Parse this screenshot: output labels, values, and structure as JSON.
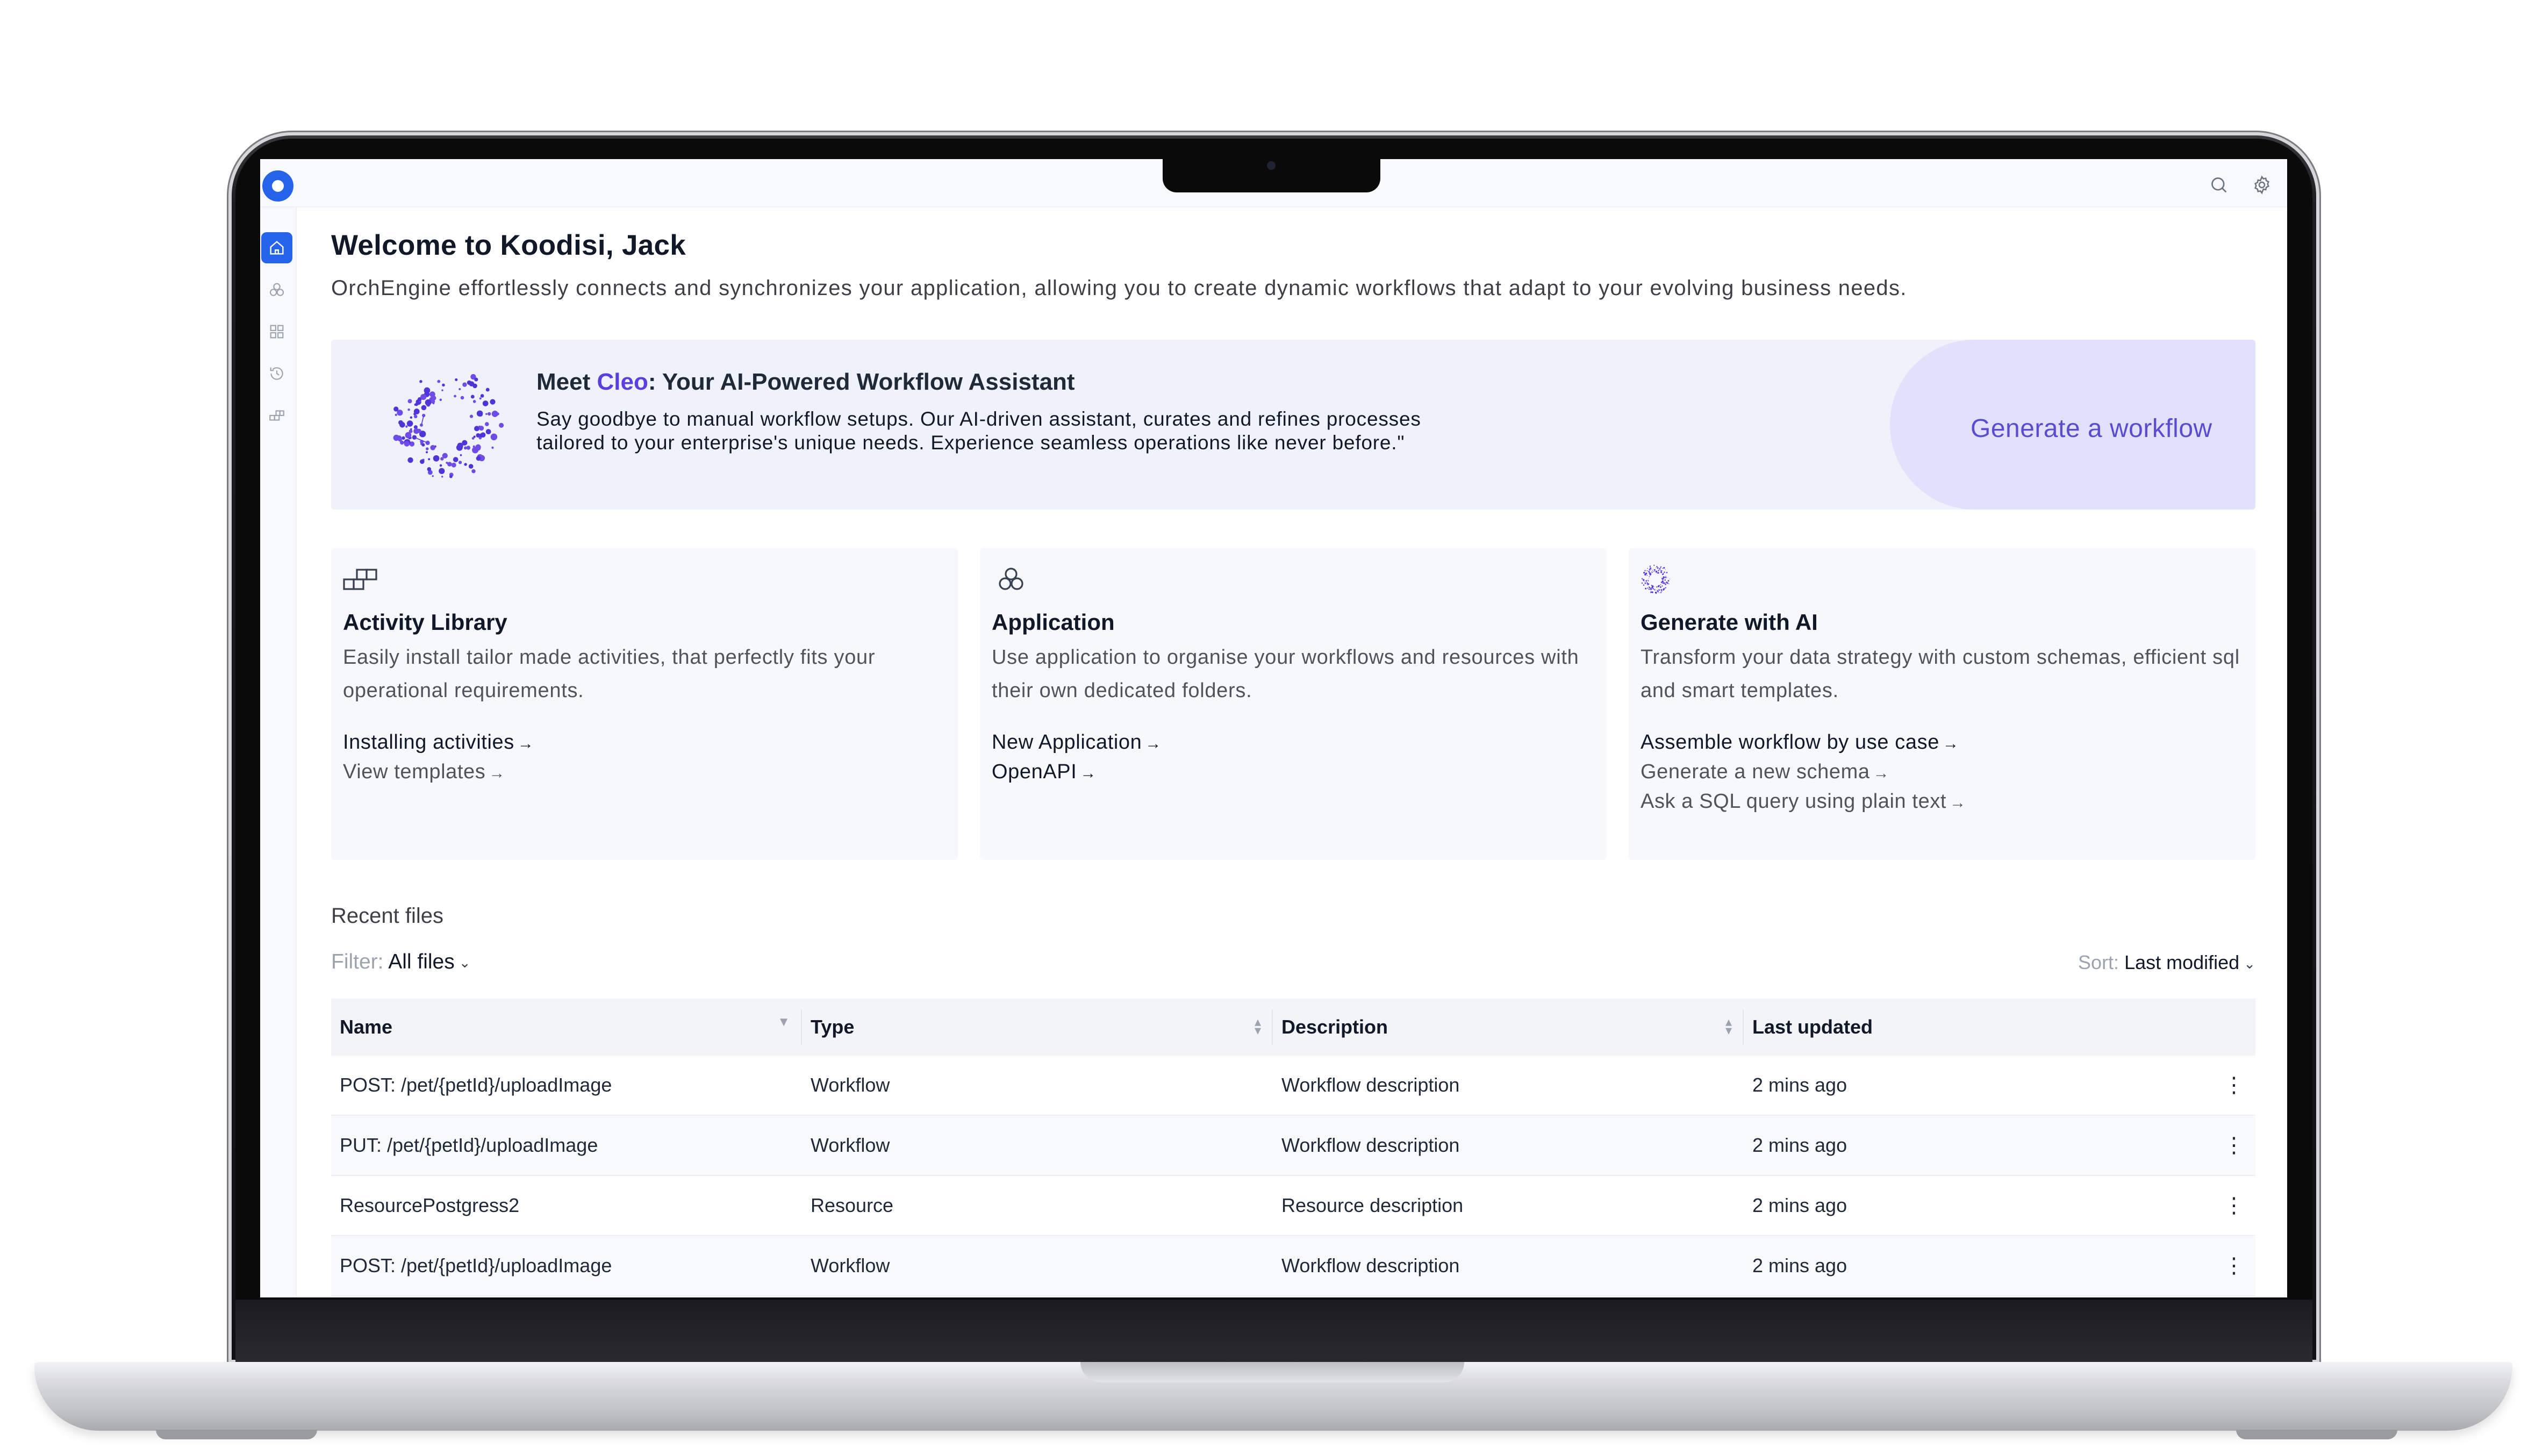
{
  "app": {
    "welcome_title": "Welcome to Koodisi, Jack",
    "welcome_subtitle": "OrchEngine effortlessly connects and synchronizes your application, allowing you to create dynamic workflows that adapt to your evolving business needs."
  },
  "topbar": {
    "icons": [
      "search-icon",
      "settings-icon"
    ]
  },
  "sidebar": {
    "items": [
      {
        "icon": "home-icon",
        "active": true
      },
      {
        "icon": "application-icon",
        "active": false
      },
      {
        "icon": "grid-icon",
        "active": false
      },
      {
        "icon": "history-icon",
        "active": false
      },
      {
        "icon": "activity-library-icon",
        "active": false
      }
    ]
  },
  "banner": {
    "title_prefix": "Meet ",
    "title_highlight": "Cleo",
    "title_suffix": ": Your AI-Powered Workflow Assistant",
    "description": "Say goodbye to manual workflow setups. Our AI-driven assistant, curates and refines processes tailored to your enterprise's unique needs. Experience seamless operations like never before.\"",
    "cta": "Generate a workflow"
  },
  "cards": [
    {
      "icon": "activity-library-icon",
      "title": "Activity Library",
      "description": "Easily install tailor made activities, that perfectly fits your operational requirements.",
      "links": [
        {
          "label": "Installing activities",
          "style": "primary"
        },
        {
          "label": "View templates",
          "style": "secondary"
        }
      ]
    },
    {
      "icon": "application-icon",
      "title": "Application",
      "description": "Use application to organise your workflows and resources with their own dedicated folders.",
      "links": [
        {
          "label": "New Application",
          "style": "primary"
        },
        {
          "label": "OpenAPI",
          "style": "primary"
        }
      ]
    },
    {
      "icon": "cleo-ai-icon",
      "title": "Generate with AI",
      "description": "Transform your data strategy with custom schemas, efficient sql and smart templates.",
      "links": [
        {
          "label": "Assemble workflow by use case",
          "style": "primary"
        },
        {
          "label": "Generate a new schema",
          "style": "secondary"
        },
        {
          "label": "Ask a SQL query using plain text",
          "style": "secondary"
        }
      ]
    }
  ],
  "recent": {
    "title": "Recent files",
    "filter_label": "Filter:",
    "filter_value": "All files",
    "sort_label": "Sort:",
    "sort_value": "Last modified",
    "columns": [
      "Name",
      "Type",
      "Description",
      "Last updated"
    ],
    "rows": [
      {
        "name": "POST:  /pet/{petId}/uploadImage",
        "type": "Workflow",
        "description": "Workflow description",
        "updated": "2 mins ago"
      },
      {
        "name": "PUT:  /pet/{petId}/uploadImage",
        "type": "Workflow",
        "description": "Workflow description",
        "updated": "2 mins ago"
      },
      {
        "name": "ResourcePostgress2",
        "type": "Resource",
        "description": "Resource description",
        "updated": "2 mins ago"
      },
      {
        "name": "POST:  /pet/{petId}/uploadImage",
        "type": "Workflow",
        "description": "Workflow description",
        "updated": "2 mins ago"
      }
    ]
  },
  "colors": {
    "accent": "#2563eb",
    "cleo": "#5b3ee0",
    "cta": "#5b4bd0"
  }
}
